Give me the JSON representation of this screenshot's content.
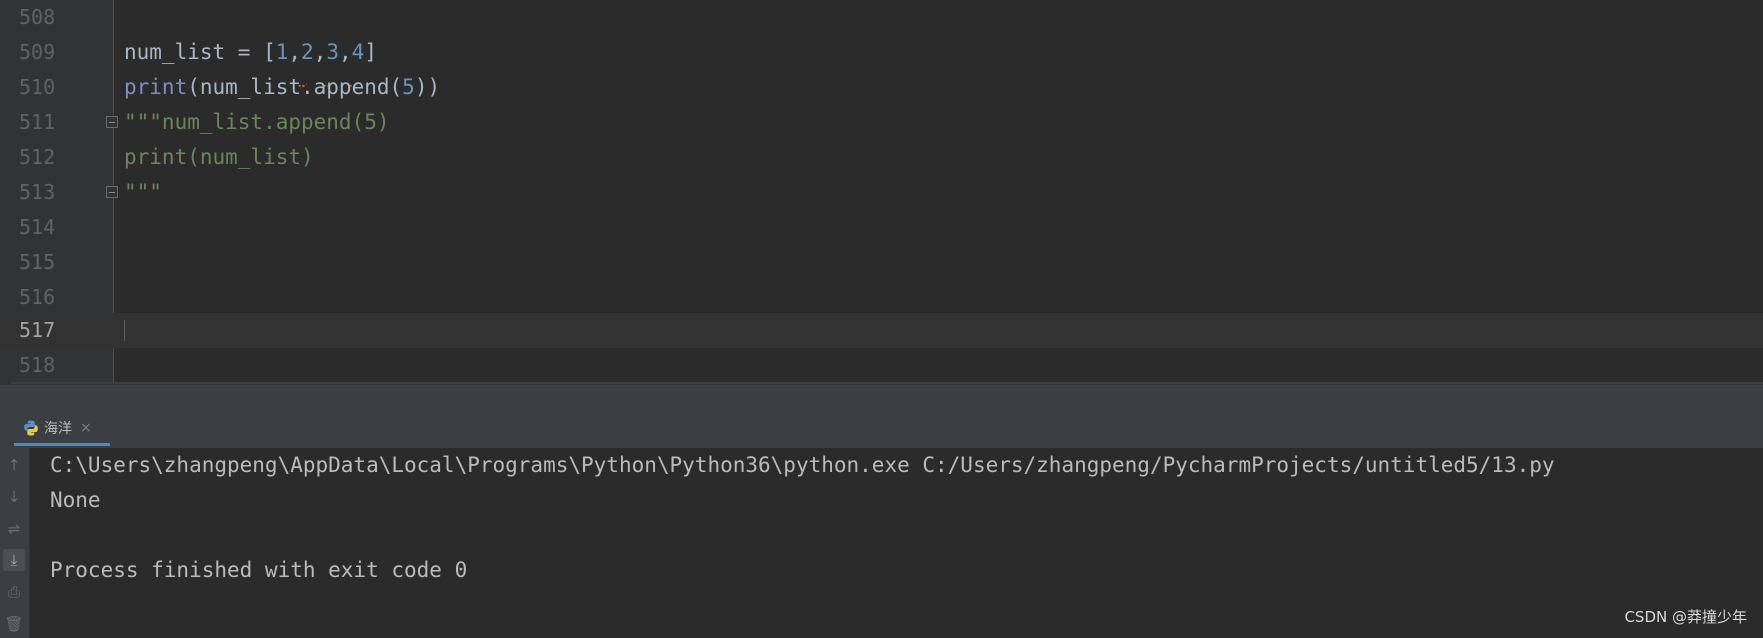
{
  "editor": {
    "lines": [
      {
        "number": "508"
      },
      {
        "number": "509"
      },
      {
        "number": "510"
      },
      {
        "number": "511"
      },
      {
        "number": "512"
      },
      {
        "number": "513"
      },
      {
        "number": "514"
      },
      {
        "number": "515"
      },
      {
        "number": "516"
      },
      {
        "number": "517"
      },
      {
        "number": "518"
      }
    ],
    "code": {
      "l509_var": "num_list = [",
      "l509_n1": "1",
      "l509_c1": ",",
      "l509_n2": "2",
      "l509_c2": ",",
      "l509_n3": "3",
      "l509_c3": ",",
      "l509_n4": "4",
      "l509_end": "]",
      "l510_print": "print",
      "l510_mid": "(num_list.append(",
      "l510_num": "5",
      "l510_end": "))",
      "l511": "\"\"\"num_list.append(5)",
      "l512": "print(num_list)",
      "l513": "\"\"\""
    },
    "current_line": "517"
  },
  "run_panel": {
    "tab_label": "海洋",
    "tab_close": "×",
    "tab_icon": "python-icon",
    "tools": [
      {
        "name": "up-arrow-icon",
        "glyph": "↑"
      },
      {
        "name": "down-arrow-icon",
        "glyph": "↓"
      },
      {
        "name": "soft-wrap-icon",
        "glyph": "⇌"
      },
      {
        "name": "scroll-to-end-icon",
        "glyph": "⤓"
      },
      {
        "name": "print-icon",
        "glyph": "⎙"
      },
      {
        "name": "trash-icon",
        "glyph": "🗑"
      }
    ],
    "console": [
      "C:\\Users\\zhangpeng\\AppData\\Local\\Programs\\Python\\Python36\\python.exe C:/Users/zhangpeng/PycharmProjects/untitled5/13.py",
      "None",
      "",
      "Process finished with exit code 0"
    ]
  },
  "watermark": "CSDN @莽撞少年",
  "colors": {
    "background": "#2b2b2b",
    "gutter": "#313335",
    "keyword": "#8888c6",
    "number": "#6897bb",
    "string": "#6a8759",
    "text": "#a9b7c6",
    "tab_underline": "#4a88c7"
  }
}
